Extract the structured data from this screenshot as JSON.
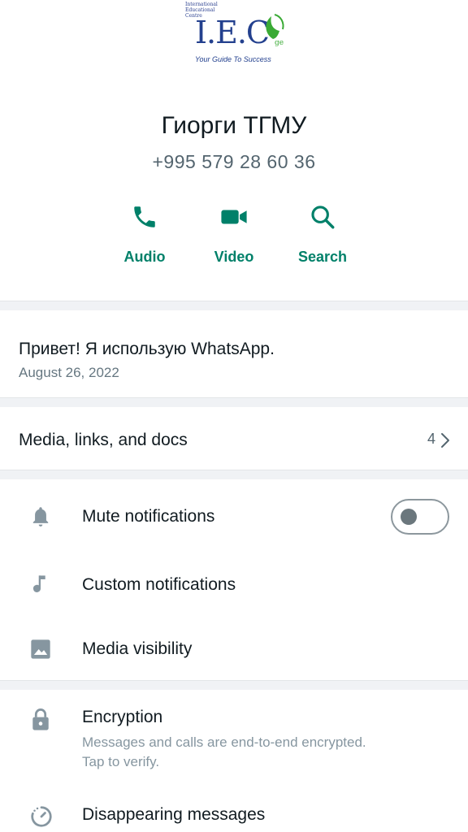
{
  "logo": {
    "small_text": [
      "International",
      "Educational",
      "Centre"
    ],
    "main_text": "I.E.C",
    "suffix": "ge",
    "tagline": "Your Guide To Success"
  },
  "contact": {
    "name": "Гиорги ТГМУ",
    "phone": "+995 579 28 60 36"
  },
  "actions": [
    {
      "label": "Audio",
      "icon": "phone-icon"
    },
    {
      "label": "Video",
      "icon": "video-icon"
    },
    {
      "label": "Search",
      "icon": "search-icon"
    }
  ],
  "about": {
    "text": "Привет! Я использую WhatsApp.",
    "date": "August 26, 2022"
  },
  "media": {
    "label": "Media, links, and docs",
    "count": "4"
  },
  "settings": {
    "mute": {
      "label": "Mute notifications",
      "icon": "bell-icon",
      "enabled": false
    },
    "custom": {
      "label": "Custom notifications",
      "icon": "music-note-icon"
    },
    "visibility": {
      "label": "Media visibility",
      "icon": "image-icon"
    },
    "encryption": {
      "label": "Encryption",
      "sub_line1": "Messages and calls are end-to-end encrypted.",
      "sub_line2": "Tap to verify.",
      "icon": "lock-icon"
    },
    "disappearing": {
      "label": "Disappearing messages",
      "icon": "timer-icon"
    }
  },
  "colors": {
    "accent": "#008069",
    "text_primary": "#111b21",
    "text_secondary": "#667781",
    "separator": "#f0f2f5"
  }
}
